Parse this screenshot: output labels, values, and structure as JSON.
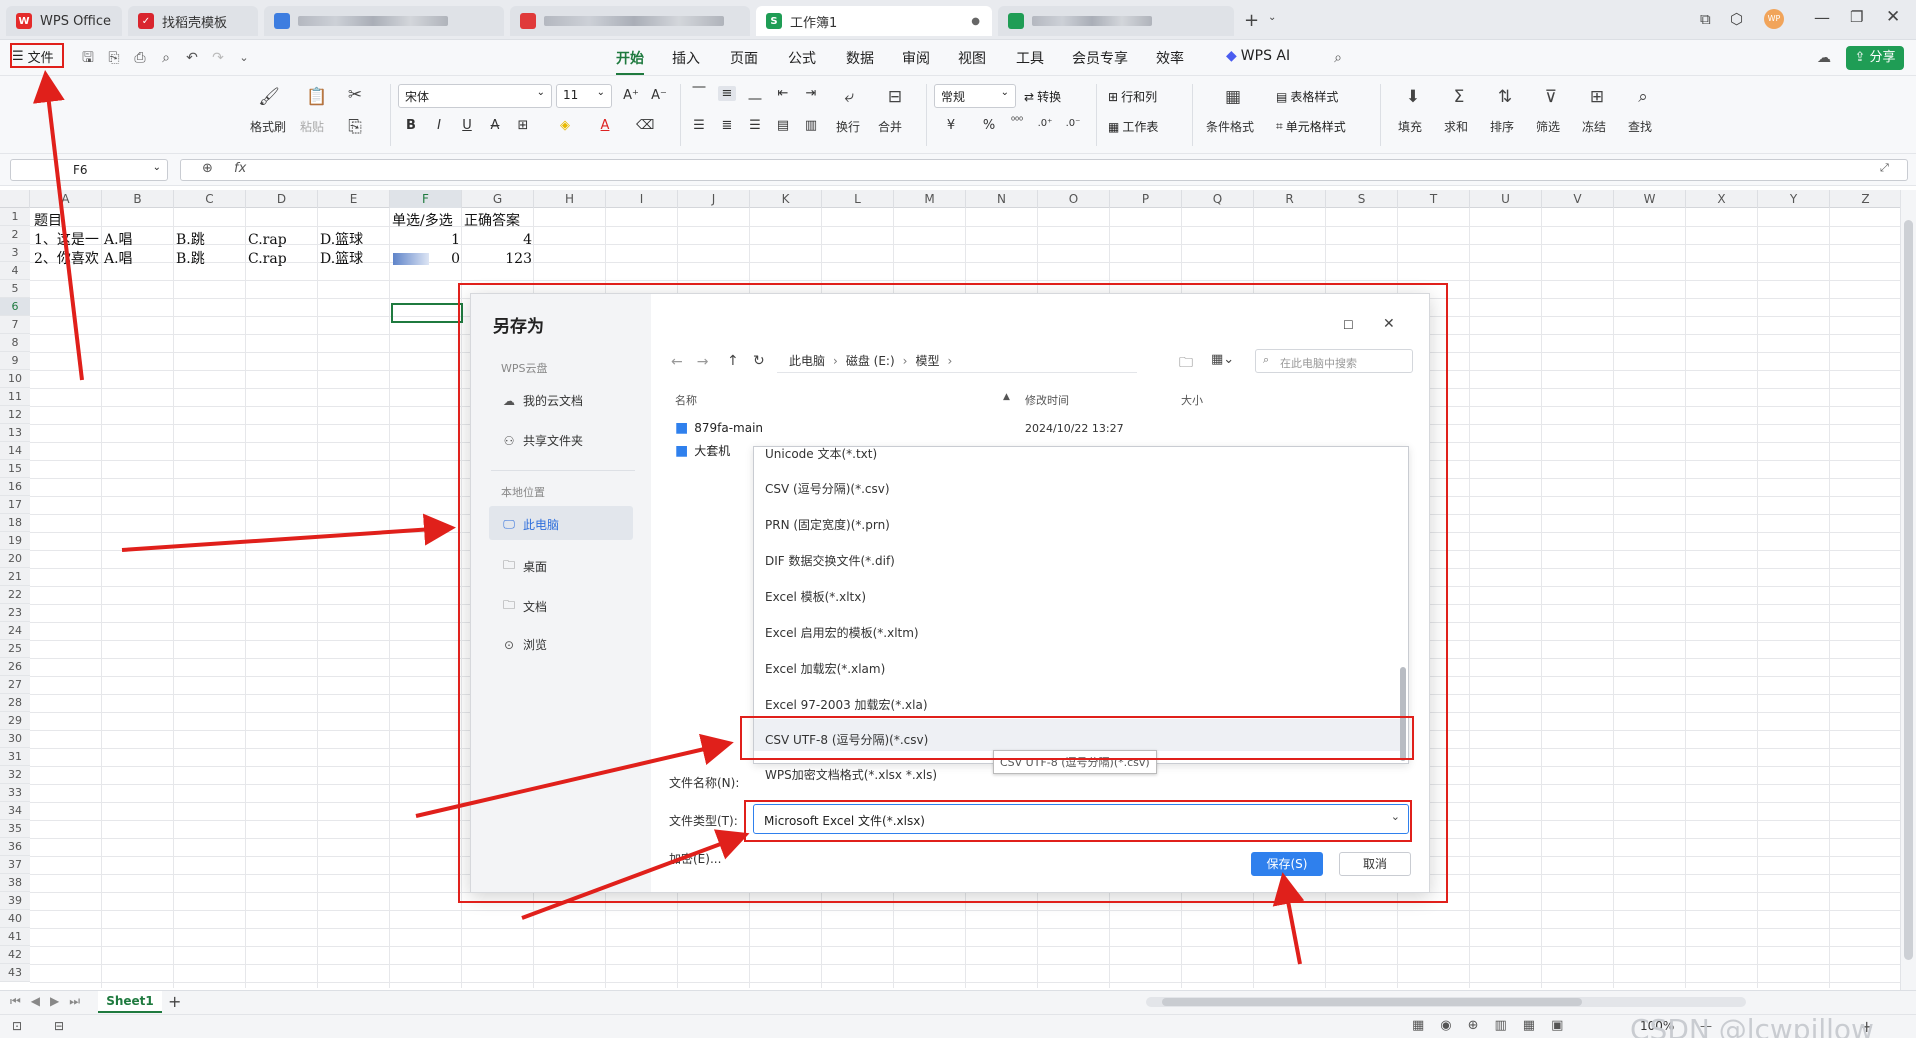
{
  "tabs": [
    {
      "label": "WPS Office",
      "type": "wps"
    },
    {
      "label": "找稻壳模板",
      "type": "daoke"
    },
    {
      "label": "",
      "type": "blurred-blue"
    },
    {
      "label": "",
      "type": "blurred-red"
    },
    {
      "label": "工作簿1",
      "type": "sheet",
      "active": true
    },
    {
      "label": "",
      "type": "blurred-green"
    }
  ],
  "titlebar": {
    "add_tab": "+",
    "account_initials": "WP"
  },
  "menu": {
    "file_label": "文件",
    "items": [
      "开始",
      "插入",
      "页面",
      "公式",
      "数据",
      "审阅",
      "视图",
      "工具",
      "会员专享",
      "效率",
      "WPS AI"
    ],
    "active": "开始",
    "share_label": "分享"
  },
  "ribbon": {
    "format_painter": "格式刷",
    "paste": "粘贴",
    "font_name": "宋体",
    "font_size": "11",
    "wrap": "换行",
    "merge": "合并",
    "number_format": "常规",
    "convert": "转换",
    "row_col": "行和列",
    "worksheet": "工作表",
    "cond_format": "条件格式",
    "table_style": "表格样式",
    "cell_style": "单元格样式",
    "fill": "填充",
    "sum": "求和",
    "sort": "排序",
    "filter": "筛选",
    "freeze": "冻结",
    "find": "查找",
    "currency": "¥",
    "percent": "%"
  },
  "formula_bar": {
    "name_box": "F6",
    "fx": "fx",
    "value": ""
  },
  "columns": [
    "A",
    "B",
    "C",
    "D",
    "E",
    "F",
    "G",
    "H",
    "I",
    "J",
    "K",
    "L",
    "M",
    "N",
    "O",
    "P",
    "Q",
    "R",
    "S",
    "T",
    "U",
    "V",
    "W",
    "X",
    "Y",
    "Z"
  ],
  "rows_count": 43,
  "cells": {
    "A1": "题目",
    "F1": "单选/多选",
    "G1": "正确答案",
    "A2": "1、这是一",
    "B2": "A.唱",
    "C2": "B.跳",
    "D2": "C.rap",
    "E2": "D.篮球",
    "F2": "1",
    "G2": "4",
    "A3": "2、你喜欢",
    "B3": "A.唱",
    "C3": "B.跳",
    "D3": "C.rap",
    "E3": "D.篮球",
    "F3": "0",
    "G3": "123"
  },
  "active_cell": "F6",
  "sheet_tabs": {
    "sheet": "Sheet1",
    "add": "+"
  },
  "status": {
    "zoom": "100%",
    "watermark": "CSDN @lcwpillow"
  },
  "dialog": {
    "title": "另存为",
    "side_section_cloud": "WPS云盘",
    "side_cloud_items": [
      "我的云文档",
      "共享文件夹"
    ],
    "side_section_local": "本地位置",
    "side_local_items": [
      "此电脑",
      "桌面",
      "文档",
      "浏览"
    ],
    "breadcrumb": [
      "此电脑",
      "磁盘 (E:)",
      "模型"
    ],
    "search_placeholder": "在此电脑中搜索",
    "col_name": "名称",
    "col_modified": "修改时间",
    "col_size": "大小",
    "files": [
      {
        "name": "879fa-main",
        "modified": "2024/10/22 13:27"
      },
      {
        "name": "大套机",
        "modified": ""
      }
    ],
    "type_options": [
      "Unicode 文本(*.txt)",
      "CSV (逗号分隔)(*.csv)",
      "PRN (固定宽度)(*.prn)",
      "DIF 数据交换文件(*.dif)",
      "Excel 模板(*.xltx)",
      "Excel 启用宏的模板(*.xltm)",
      "Excel 加载宏(*.xlam)",
      "Excel 97-2003 加载宏(*.xla)",
      "CSV UTF-8 (逗号分隔)(*.csv)",
      "WPS加密文档格式(*.xlsx *.xls)"
    ],
    "highlighted_option": "CSV UTF-8 (逗号分隔)(*.csv)",
    "tooltip": "CSV UTF-8 (逗号分隔)(*.csv)",
    "filename_label": "文件名称(N):",
    "filetype_label": "文件类型(T):",
    "filetype_value": "Microsoft Excel 文件(*.xlsx)",
    "encrypt_label": "加密(E)...",
    "save": "保存(S)",
    "cancel": "取消"
  },
  "colors": {
    "accent": "#1f7a3f",
    "annotation": "#e0201b",
    "primary_button": "#2f80ed"
  }
}
